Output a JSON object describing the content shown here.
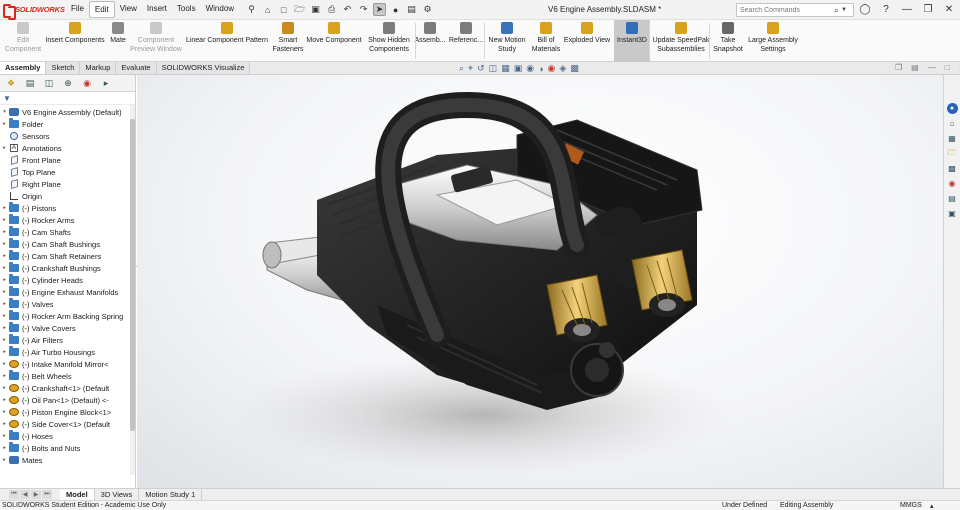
{
  "app": {
    "logo_text": "SOLIDWORKS",
    "document_title": "V6 Engine Assembly.SLDASM *"
  },
  "menu": [
    "File",
    "Edit",
    "View",
    "Insert",
    "Tools",
    "Window"
  ],
  "search": {
    "placeholder": "Search Commands"
  },
  "command_manager": [
    {
      "label": "Edit Component",
      "disabled": true,
      "icon_color": "#c9c9c9"
    },
    {
      "label": "Insert Components",
      "disabled": false,
      "icon_color": "#d9a21c"
    },
    {
      "label": "Mate",
      "disabled": false,
      "icon_color": "#8a8a8a"
    },
    {
      "label": "Component Preview Window",
      "disabled": true,
      "icon_color": "#c9c9c9"
    },
    {
      "label": "Linear Component Pattern",
      "disabled": false,
      "icon_color": "#d9a21c"
    },
    {
      "label": "Smart Fasteners",
      "disabled": false,
      "icon_color": "#c98a1c"
    },
    {
      "label": "Move Component",
      "disabled": false,
      "icon_color": "#d9a21c"
    },
    {
      "label": "Show Hidden Components",
      "disabled": false,
      "icon_color": "#7c7c7c"
    },
    {
      "label": "Assemb...",
      "disabled": false,
      "icon_color": "#7c7c7c"
    },
    {
      "label": "Referenc...",
      "disabled": false,
      "icon_color": "#7c7c7c"
    },
    {
      "label": "New Motion Study",
      "disabled": false,
      "icon_color": "#3b73b9"
    },
    {
      "label": "Bill of Materials",
      "disabled": false,
      "icon_color": "#d9a21c"
    },
    {
      "label": "Exploded View",
      "disabled": false,
      "icon_color": "#d9a21c"
    },
    {
      "label": "Instant3D",
      "disabled": false,
      "active": true,
      "icon_color": "#2f6fb8"
    },
    {
      "label": "Update SpeedPak Subassemblies",
      "disabled": false,
      "icon_color": "#d9a21c"
    },
    {
      "label": "Take Snapshot",
      "disabled": false,
      "icon_color": "#666666"
    },
    {
      "label": "Large Assembly Settings",
      "disabled": false,
      "icon_color": "#d9a21c"
    }
  ],
  "tabs": [
    "Assembly",
    "Sketch",
    "Markup",
    "Evaluate",
    "SOLIDWORKS Visualize"
  ],
  "tree": {
    "root": "V6 Engine Assembly  (Default<Display State-1>)",
    "root_display": "V6 Engine Assembly  (Default)",
    "items": [
      {
        "label": "Folder",
        "icon": "folder-icon",
        "expand": true
      },
      {
        "label": "Sensors",
        "icon": "sensor-icon",
        "expand": false
      },
      {
        "label": "Annotations",
        "icon": "annotation-icon",
        "expand": true
      },
      {
        "label": "Front Plane",
        "icon": "plane-icon",
        "expand": false
      },
      {
        "label": "Top Plane",
        "icon": "plane-icon",
        "expand": false
      },
      {
        "label": "Right Plane",
        "icon": "plane-icon",
        "expand": false
      },
      {
        "label": "Origin",
        "icon": "origin-icon",
        "expand": false
      },
      {
        "label": "(-) Pistons",
        "icon": "folder-icon",
        "expand": true
      },
      {
        "label": "(-) Rocker Arms",
        "icon": "folder-icon",
        "expand": true
      },
      {
        "label": "(-) Cam Shafts",
        "icon": "folder-icon",
        "expand": true
      },
      {
        "label": "(-) Cam Shaft Bushings",
        "icon": "folder-icon",
        "expand": true
      },
      {
        "label": "(-) Cam Shaft Retainers",
        "icon": "folder-icon",
        "expand": true
      },
      {
        "label": "(-) Crankshaft Bushings",
        "icon": "folder-icon",
        "expand": true
      },
      {
        "label": "(-) Cylinder Heads",
        "icon": "folder-icon",
        "expand": true
      },
      {
        "label": "(-) Engine Exhaust Manifolds",
        "icon": "folder-icon",
        "expand": true
      },
      {
        "label": "(-) Valves",
        "icon": "folder-icon",
        "expand": true
      },
      {
        "label": "(-) Rocker Arm Backing Spring",
        "icon": "folder-icon",
        "expand": true
      },
      {
        "label": "(-) Valve Covers",
        "icon": "folder-icon",
        "expand": true
      },
      {
        "label": "(-) Air Filters",
        "icon": "folder-icon",
        "expand": true
      },
      {
        "label": "(-) Air Turbo Housings",
        "icon": "folder-icon",
        "expand": true
      },
      {
        "label": "(-) Intake Manifold Mirror<",
        "icon": "part-icon",
        "expand": true
      },
      {
        "label": "(-) Belt Wheels",
        "icon": "folder-icon",
        "expand": true
      },
      {
        "label": "(-) Crankshaft<1> (Default",
        "icon": "part-icon",
        "expand": true
      },
      {
        "label": "(-) Oil Pan<1> (Default) <-",
        "icon": "part-icon",
        "expand": true
      },
      {
        "label": "(-) Piston Engine Block<1>",
        "icon": "part-icon",
        "expand": true
      },
      {
        "label": "(-) Side Cover<1> (Default",
        "icon": "part-icon",
        "expand": true
      },
      {
        "label": "(-) Hoses",
        "icon": "folder-icon",
        "expand": true
      },
      {
        "label": "(-) Bolts and Nuts",
        "icon": "folder-icon",
        "expand": true
      },
      {
        "label": "Mates",
        "icon": "mates-icon",
        "expand": true
      }
    ]
  },
  "bottom_tabs": [
    "Model",
    "3D Views",
    "Motion Study 1"
  ],
  "status": {
    "left": "SOLIDWORKS Student Edition - Academic Use Only",
    "state": "Under Defined",
    "mode": "Editing Assembly",
    "units": "MMGS"
  }
}
